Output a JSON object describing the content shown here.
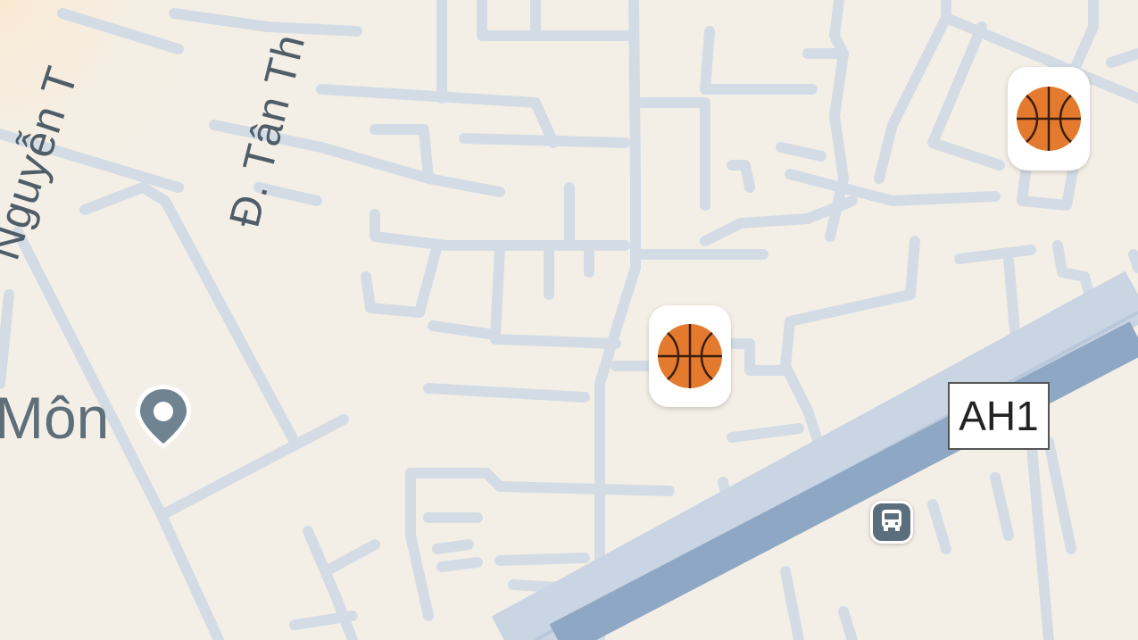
{
  "map": {
    "streets": {
      "nguyen": "Nguyễn T",
      "tan_thoi": "Đ. Tân Th"
    },
    "places": {
      "mon_label": "Môn"
    },
    "route_shield": "AH1",
    "pois": [
      {
        "icon": "basketball-icon"
      },
      {
        "icon": "basketball-icon"
      }
    ],
    "transit": {
      "icon": "bus-icon"
    },
    "colors": {
      "background": "#f4efe6",
      "minor_road": "#d3dce5",
      "highway": "#8ea7c4",
      "highway_edge": "#c9d5e2",
      "pin": "#6f8391",
      "basketball": "#e47a2e"
    }
  }
}
